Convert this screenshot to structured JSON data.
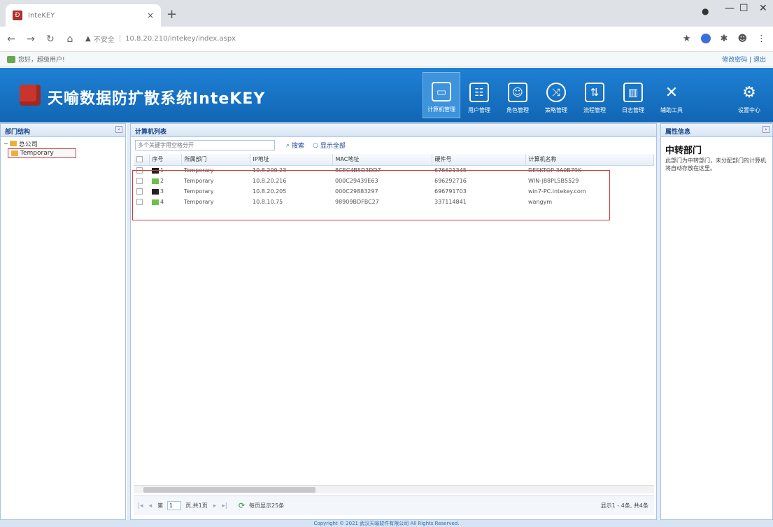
{
  "browser": {
    "tab_title": "InteKEY",
    "tab_close": "×",
    "new_tab": "+",
    "address_warning": "不安全",
    "address_url": "10.8.20.210/intekey/index.aspx"
  },
  "userbar": {
    "greeting": "您好，超级用户!",
    "links": "修改密码 | 退出"
  },
  "header": {
    "brand": "天喻数据防扩散系统InteKEY",
    "nav": [
      {
        "label": "计算机管理",
        "icon": "monitor-icon"
      },
      {
        "label": "用户管理",
        "icon": "users-icon"
      },
      {
        "label": "角色管理",
        "icon": "roles-icon"
      },
      {
        "label": "策略管理",
        "icon": "policy-icon"
      },
      {
        "label": "流程管理",
        "icon": "flow-icon"
      },
      {
        "label": "日志管理",
        "icon": "log-icon"
      },
      {
        "label": "辅助工具",
        "icon": "tools-icon"
      },
      {
        "label": "设置中心",
        "icon": "settings-icon"
      }
    ]
  },
  "left_panel": {
    "title": "部门结构",
    "root": "总公司",
    "child": "Temporary"
  },
  "center_panel": {
    "title": "计算机列表",
    "search_placeholder": "多个关键字用空格分开",
    "search_button": "搜索",
    "show_all_button": "显示全部",
    "columns": [
      "序号",
      "所属部门",
      "IP地址",
      "MAC地址",
      "硬件号",
      "计算机名称"
    ],
    "rows": [
      {
        "no": "1",
        "dept": "Temporary",
        "ip": "10.8.200.23",
        "mac": "8CEC4B5D3DD7",
        "hw": "676621345",
        "name": "DESKTOP-3A0B79K",
        "status": "offline"
      },
      {
        "no": "2",
        "dept": "Temporary",
        "ip": "10.8.20.216",
        "mac": "000C29439E63",
        "hw": "696292716",
        "name": "WIN-J88PL5B5529",
        "status": "online"
      },
      {
        "no": "3",
        "dept": "Temporary",
        "ip": "10.8.20.205",
        "mac": "000C29883297",
        "hw": "696791703",
        "name": "win7-PC.intekey.com",
        "status": "offline"
      },
      {
        "no": "4",
        "dept": "Temporary",
        "ip": "10.8.10.75",
        "mac": "98909BDFBC27",
        "hw": "337114841",
        "name": "wangym",
        "status": "online"
      }
    ],
    "pager": {
      "page_label_before": "第",
      "page_value": "1",
      "page_label_after": "页,共1页",
      "per_page": "每页显示25条",
      "summary": "显示1 - 4条, 共4条"
    }
  },
  "right_panel": {
    "title": "属性信息",
    "heading": "中转部门",
    "text": "此部门为中转部门，未分配部门的计算机将自动存放在这里。"
  },
  "footer": {
    "text": "Copyright © 2021 武汉天喻软件有限公司 All Rights Reserved."
  },
  "colors": {
    "banner": "#1166b4",
    "highlight": "#d63b3b",
    "online": "#6cc04a",
    "offline": "#222222"
  }
}
